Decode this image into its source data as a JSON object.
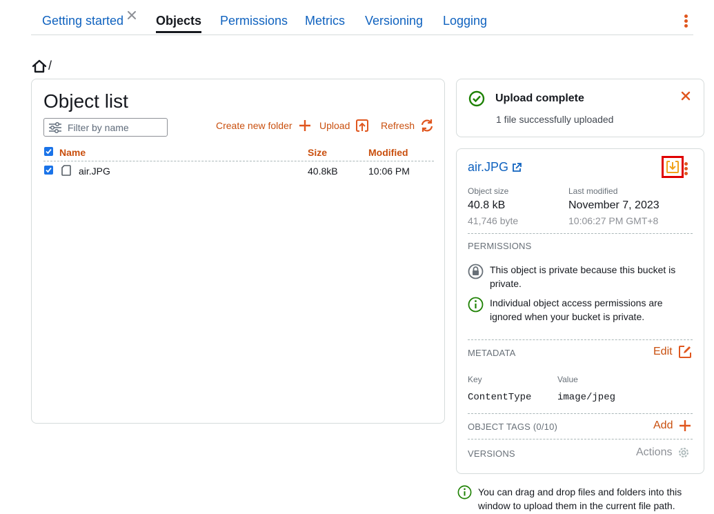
{
  "tabs": [
    {
      "label": "Getting started"
    },
    {
      "label": "Objects"
    },
    {
      "label": "Permissions"
    },
    {
      "label": "Metrics"
    },
    {
      "label": "Versioning"
    },
    {
      "label": "Logging"
    }
  ],
  "active_tab": "Objects",
  "breadcrumb": {
    "separator": "/"
  },
  "object_list": {
    "title": "Object list",
    "filter_placeholder": "Filter by name",
    "create_folder_label": "Create new folder",
    "upload_label": "Upload",
    "refresh_label": "Refresh",
    "columns": {
      "name": "Name",
      "size": "Size",
      "modified": "Modified"
    },
    "rows": [
      {
        "name": "air.JPG",
        "size": "40.8kB",
        "modified": "10:06 PM",
        "checked": true
      }
    ]
  },
  "notification": {
    "title": "Upload complete",
    "message": "1 file successfully uploaded"
  },
  "details": {
    "file_name": "air.JPG",
    "object_size_label": "Object size",
    "object_size": "40.8 kB",
    "object_size_bytes": "41,746 byte",
    "last_modified_label": "Last modified",
    "last_modified_date": "November 7, 2023",
    "last_modified_time": "10:06:27 PM GMT+8",
    "permissions_heading": "PERMISSIONS",
    "permission_private": "This object is private because this bucket is private.",
    "permission_ignored": "Individual object access permissions are ignored when your bucket is private.",
    "metadata_heading": "METADATA",
    "metadata_edit_label": "Edit",
    "metadata_key_header": "Key",
    "metadata_value_header": "Value",
    "metadata_key": "ContentType",
    "metadata_value": "image/jpeg",
    "tags_heading": "OBJECT TAGS (0/10)",
    "tags_add_label": "Add",
    "versions_heading": "VERSIONS",
    "versions_actions_label": "Actions"
  },
  "hint": "You can drag and drop files and folders into this window to upload them in the current file path.",
  "colors": {
    "accent": "#e0561e",
    "link": "#0f62bf",
    "success": "#1d8102",
    "highlight": "#e00000"
  }
}
